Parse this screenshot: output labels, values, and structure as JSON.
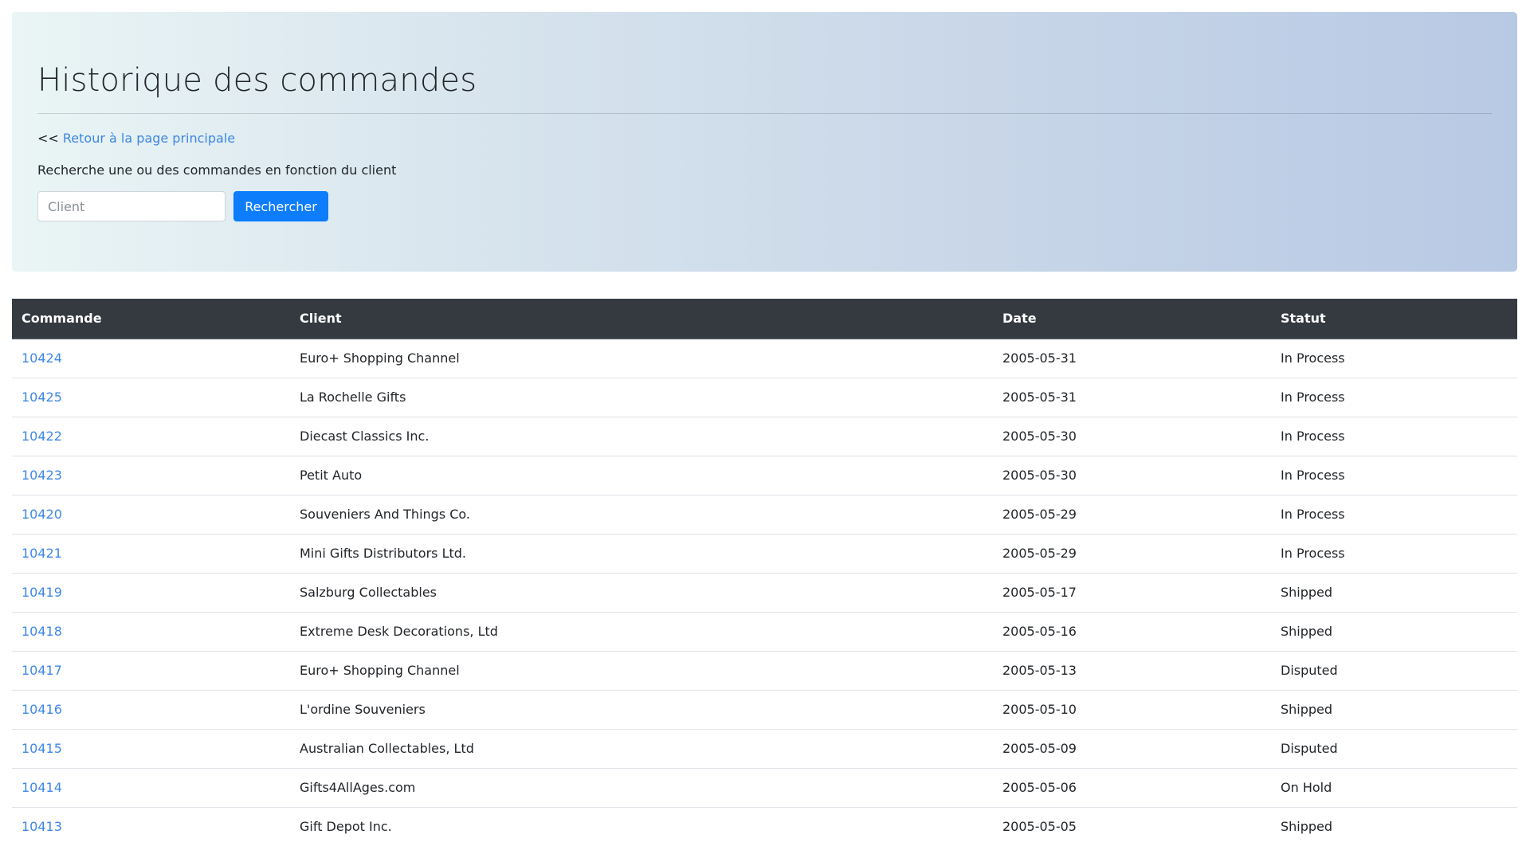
{
  "header": {
    "title": "Historique des commandes",
    "back_prefix": "<<",
    "back_link_label": "Retour à la page principale",
    "search_description": "Recherche une ou des commandes en fonction du client"
  },
  "search": {
    "placeholder": "Client",
    "value": "",
    "button_label": "Rechercher"
  },
  "table": {
    "columns": [
      "Commande",
      "Client",
      "Date",
      "Statut"
    ],
    "rows": [
      {
        "order": "10424",
        "client": "Euro+ Shopping Channel",
        "date": "2005-05-31",
        "status": "In Process"
      },
      {
        "order": "10425",
        "client": "La Rochelle Gifts",
        "date": "2005-05-31",
        "status": "In Process"
      },
      {
        "order": "10422",
        "client": "Diecast Classics Inc.",
        "date": "2005-05-30",
        "status": "In Process"
      },
      {
        "order": "10423",
        "client": "Petit Auto",
        "date": "2005-05-30",
        "status": "In Process"
      },
      {
        "order": "10420",
        "client": "Souveniers And Things Co.",
        "date": "2005-05-29",
        "status": "In Process"
      },
      {
        "order": "10421",
        "client": "Mini Gifts Distributors Ltd.",
        "date": "2005-05-29",
        "status": "In Process"
      },
      {
        "order": "10419",
        "client": "Salzburg Collectables",
        "date": "2005-05-17",
        "status": "Shipped"
      },
      {
        "order": "10418",
        "client": "Extreme Desk Decorations, Ltd",
        "date": "2005-05-16",
        "status": "Shipped"
      },
      {
        "order": "10417",
        "client": "Euro+ Shopping Channel",
        "date": "2005-05-13",
        "status": "Disputed"
      },
      {
        "order": "10416",
        "client": "L'ordine Souveniers",
        "date": "2005-05-10",
        "status": "Shipped"
      },
      {
        "order": "10415",
        "client": "Australian Collectables, Ltd",
        "date": "2005-05-09",
        "status": "Disputed"
      },
      {
        "order": "10414",
        "client": "Gifts4AllAges.com",
        "date": "2005-05-06",
        "status": "On Hold"
      },
      {
        "order": "10413",
        "client": "Gift Depot Inc.",
        "date": "2005-05-05",
        "status": "Shipped"
      }
    ]
  },
  "colors": {
    "link": "#3d87e6",
    "primary_button": "#0d7dfb",
    "table_header_bg": "#343a40",
    "table_header_text": "#ffffff"
  }
}
